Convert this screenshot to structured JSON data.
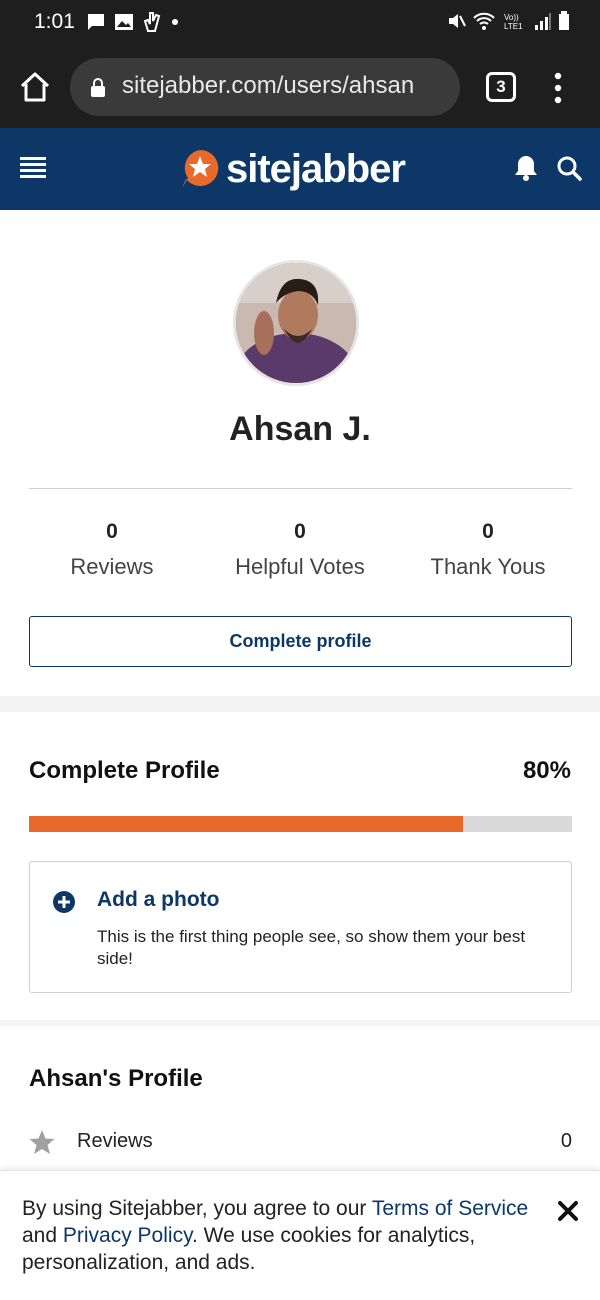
{
  "status_bar": {
    "time": "1:01",
    "left_icons": [
      "message-icon",
      "image-icon",
      "hand-icon",
      "dot-icon"
    ],
    "right_icons": [
      "mute-icon",
      "wifi-icon",
      "lte-icon",
      "signal-icon",
      "battery-icon"
    ]
  },
  "browser": {
    "url": "sitejabber.com/users/ahsan",
    "tab_count": "3",
    "icons": [
      "home-icon",
      "lock-icon",
      "more-vert-icon"
    ]
  },
  "site_header": {
    "logo_text": "sitejabber",
    "icons": [
      "hamburger-icon",
      "bell-icon",
      "search-icon"
    ],
    "colors": {
      "header_bg": "#0d3766",
      "logo_badge": "#e8692a"
    }
  },
  "profile": {
    "name": "Ahsan J.",
    "stats": [
      {
        "value": "0",
        "label": "Reviews"
      },
      {
        "value": "0",
        "label": "Helpful Votes"
      },
      {
        "value": "0",
        "label": "Thank Yous"
      }
    ],
    "complete_button_label": "Complete profile"
  },
  "complete_profile": {
    "title": "Complete Profile",
    "percent_label": "80%",
    "progress_fraction": 0.8,
    "progress_color": "#e8692a",
    "tip": {
      "title": "Add a photo",
      "text": "This is the first thing people see, so show them your best side!"
    }
  },
  "user_profile": {
    "title": "Ahsan's Profile",
    "rows": [
      {
        "label": "Reviews",
        "value": "0",
        "icon": "star-icon"
      }
    ]
  },
  "cookie_banner": {
    "text_1": "By using Sitejabber, you agree to our ",
    "terms_link": "Terms of Service",
    "text_2": " and ",
    "privacy_link": "Privacy Policy",
    "text_3": ". We use cookies for analytics, personalization, and ads."
  }
}
